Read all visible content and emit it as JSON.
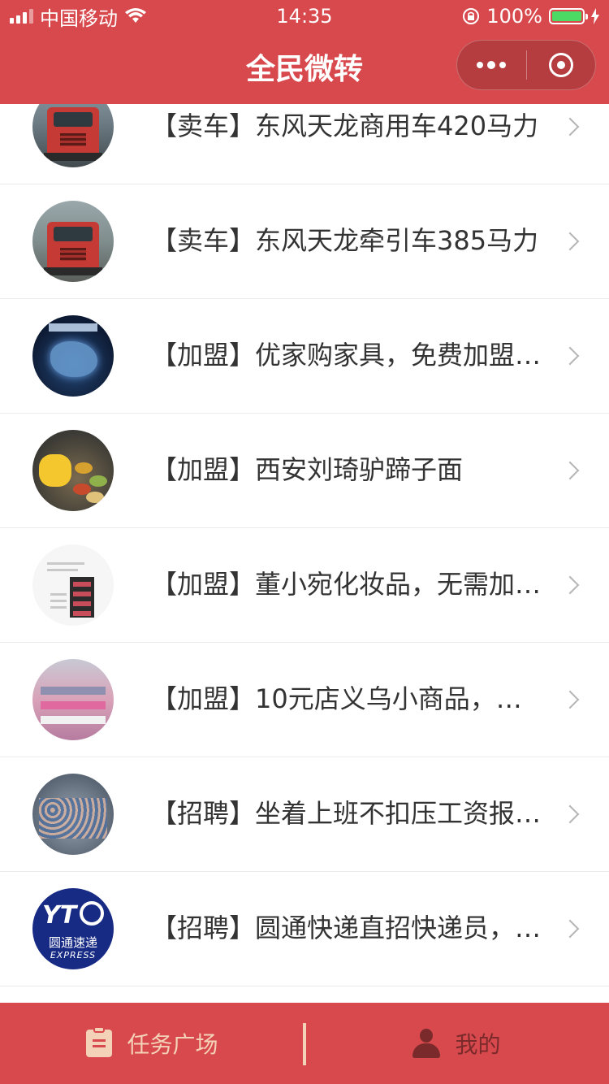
{
  "status_bar": {
    "carrier": "中国移动",
    "time": "14:35",
    "battery": "100%"
  },
  "header": {
    "title": "全民微转"
  },
  "list": {
    "items": [
      {
        "label": "【卖车】东风天龙商用车420马力",
        "thumb": "truck-icon"
      },
      {
        "label": "【卖车】东风天龙牵引车385马力",
        "thumb": "truck-icon"
      },
      {
        "label": "【加盟】优家购家具，免费加盟…",
        "thumb": "map-icon"
      },
      {
        "label": "【加盟】西安刘琦驴蹄子面",
        "thumb": "food-icon"
      },
      {
        "label": "【加盟】董小宛化妆品，无需加…",
        "thumb": "cosmetics-icon"
      },
      {
        "label": "【加盟】10元店义乌小商品，…",
        "thumb": "shop-icon"
      },
      {
        "label": "【招聘】坐着上班不扣压工资报…",
        "thumb": "group-icon"
      },
      {
        "label": "【招聘】圆通快递直招快递员，…",
        "thumb": "yto-logo"
      }
    ]
  },
  "yto": {
    "mark": "YT",
    "cn": "圆通速递",
    "en": "EXPRESS"
  },
  "tabbar": {
    "tab1_label": "任务广场",
    "tab2_label": "我的"
  },
  "colors": {
    "brand": "#d8494d",
    "tab_active": "#f3d2b8",
    "tab_inactive": "#7a2a2b"
  }
}
